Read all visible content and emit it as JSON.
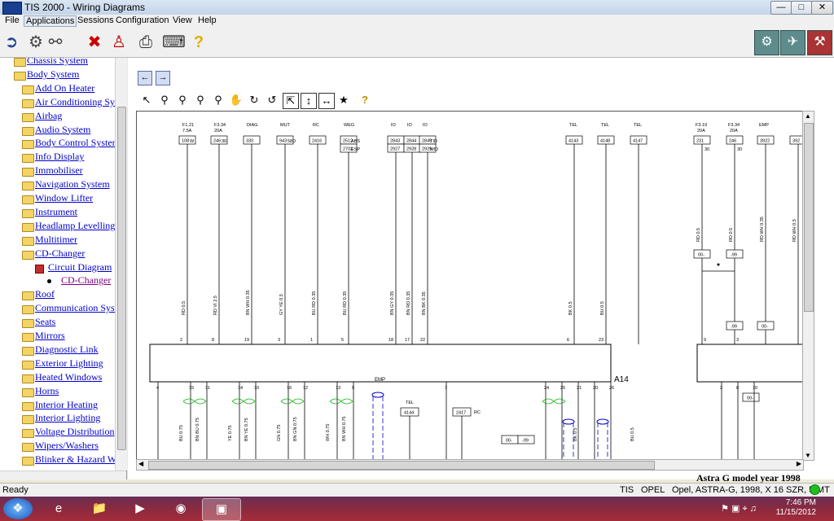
{
  "window": {
    "title": "TIS 2000 - Wiring Diagrams"
  },
  "menu": [
    "File",
    "Applications",
    "Sessions",
    "Configuration",
    "View",
    "Help"
  ],
  "tree": {
    "items": [
      {
        "label": "Chassis System",
        "level": 1
      },
      {
        "label": "Body System",
        "level": 1
      },
      {
        "label": "Add On Heater",
        "level": 2
      },
      {
        "label": "Air Conditioning Sys",
        "level": 2
      },
      {
        "label": "Airbag",
        "level": 2
      },
      {
        "label": "Audio System",
        "level": 2
      },
      {
        "label": "Body Control Syster",
        "level": 2
      },
      {
        "label": "Info Display",
        "level": 2
      },
      {
        "label": "Immobiliser",
        "level": 2
      },
      {
        "label": "Navigation System",
        "level": 2
      },
      {
        "label": "Window Lifter",
        "level": 2
      },
      {
        "label": "Instrument",
        "level": 2
      },
      {
        "label": "Headlamp Levelling",
        "level": 2
      },
      {
        "label": "Multitimer",
        "level": 2
      },
      {
        "label": "CD-Changer",
        "level": 2
      },
      {
        "label": "Circuit Diagram",
        "level": 3
      },
      {
        "label": "CD-Changer",
        "level": 4
      },
      {
        "label": "Roof",
        "level": 2
      },
      {
        "label": "Communication Syst",
        "level": 2
      },
      {
        "label": "Seats",
        "level": 2
      },
      {
        "label": "Mirrors",
        "level": 2
      },
      {
        "label": "Diagnostic Link",
        "level": 2
      },
      {
        "label": "Exterior Lighting",
        "level": 2
      },
      {
        "label": "Heated Windows",
        "level": 2
      },
      {
        "label": "Horns",
        "level": 2
      },
      {
        "label": "Interior Heating",
        "level": 2
      },
      {
        "label": "Interior Lighting",
        "level": 2
      },
      {
        "label": "Voltage Distribution",
        "level": 2
      },
      {
        "label": "Wipers/Washers",
        "level": 2
      },
      {
        "label": "Blinker & Hazard W",
        "level": 2
      }
    ]
  },
  "diagram": {
    "wires": [
      {
        "top": "F1.21",
        "top2": "7.5A",
        "box": "108",
        "side": "W",
        "color": "RD 0.5",
        "pin": "2"
      },
      {
        "top": "F3.34",
        "top2": "20A",
        "box": "246",
        "side": "30",
        "color": "RD VI 2.5",
        "pin": "8"
      },
      {
        "top": "DIAG",
        "top2": "",
        "box": "330",
        "side": "",
        "color": "BN WH 0.35",
        "pin": "19"
      },
      {
        "top": "MUT",
        "top2": "",
        "box": "943",
        "side": "58D",
        "color": "GY YE 0.5",
        "pin": "3"
      },
      {
        "top": "RC",
        "top2": "",
        "box": "2416",
        "side": "",
        "color": "BU RD 0.35",
        "pin": "1"
      },
      {
        "top": "WEG",
        "top2": "",
        "box": "2512",
        "box2": "2702",
        "side": "ABS",
        "side2": "ESP",
        "color": "BU RD 0.35",
        "pin": "5"
      },
      {
        "top": "IO",
        "top2": "",
        "box": "2843",
        "box2": "2927",
        "side": "",
        "color": "BN GY 0.35",
        "pin": "18"
      },
      {
        "top": "IO",
        "top2": "",
        "box": "2844",
        "box2": "2928",
        "side": "",
        "color": "BN RD 0.35",
        "pin": "17"
      },
      {
        "top": "IO",
        "top2": "",
        "box": "2845",
        "box2": "2929",
        "side": "TID",
        "side2": "MID",
        "color": "BN BK 0.35",
        "pin": "22"
      },
      {
        "top": "TEL",
        "top2": "",
        "box": "4143",
        "side": "",
        "color": "BK 0.5",
        "pin": "6"
      },
      {
        "top": "TEL",
        "top2": "",
        "box": "4148",
        "side": "",
        "color": "BU 0.5",
        "pin": "23"
      },
      {
        "top": "TEL",
        "top2": "",
        "box": "4147",
        "side": "",
        "color": "",
        "pin": ""
      }
    ],
    "right_wires": [
      {
        "top": "F3.19",
        "top2": "20A",
        "box": "231",
        "side": "30",
        "color": "RD 0.5"
      },
      {
        "top": "F3.34",
        "top2": "20A",
        "box": "246",
        "side": "30",
        "color": "RD 0.5"
      },
      {
        "top": "EMP",
        "top2": "",
        "box": "3922",
        "side": "",
        "color": "RD WH 0.35"
      },
      {
        "top": "",
        "top2": "",
        "box": "392",
        "side": "",
        "color": "RD WH 0.5"
      }
    ],
    "connectors": [
      "00-",
      "-99",
      "-99",
      "00-",
      "-99",
      "00-",
      "00-",
      "-99"
    ],
    "component_label": "A14",
    "emp_label": "EMP",
    "tel_label": "TEL",
    "rc_label": "RC",
    "box_4144": "4144",
    "box_2417": "2417",
    "bottom_pins": [
      "4",
      "15",
      "11",
      "14",
      "10",
      "16",
      "12",
      "13",
      "9",
      "7",
      "24",
      "25",
      "21",
      "20",
      "26"
    ],
    "bottom_colors": [
      "BU 0.75",
      "BN BU 0.75",
      "YE 0.75",
      "BN YE 0.75",
      "GN 0.75",
      "BN GN 0.75",
      "WH 0.75",
      "BN WH 0.75",
      "BK 0.5",
      "BU 0.5"
    ],
    "right_pins": [
      "9",
      "3",
      "2",
      "8",
      "10"
    ],
    "caption": "Astra G model year 1998"
  },
  "status": {
    "ready": "Ready",
    "app": "TIS",
    "make": "OPEL",
    "vehicle": "Opel, ASTRA-G, 1998, X 16 SZR, 5-MT"
  },
  "clock": {
    "time": "7:46 PM",
    "date": "11/15/2012"
  }
}
